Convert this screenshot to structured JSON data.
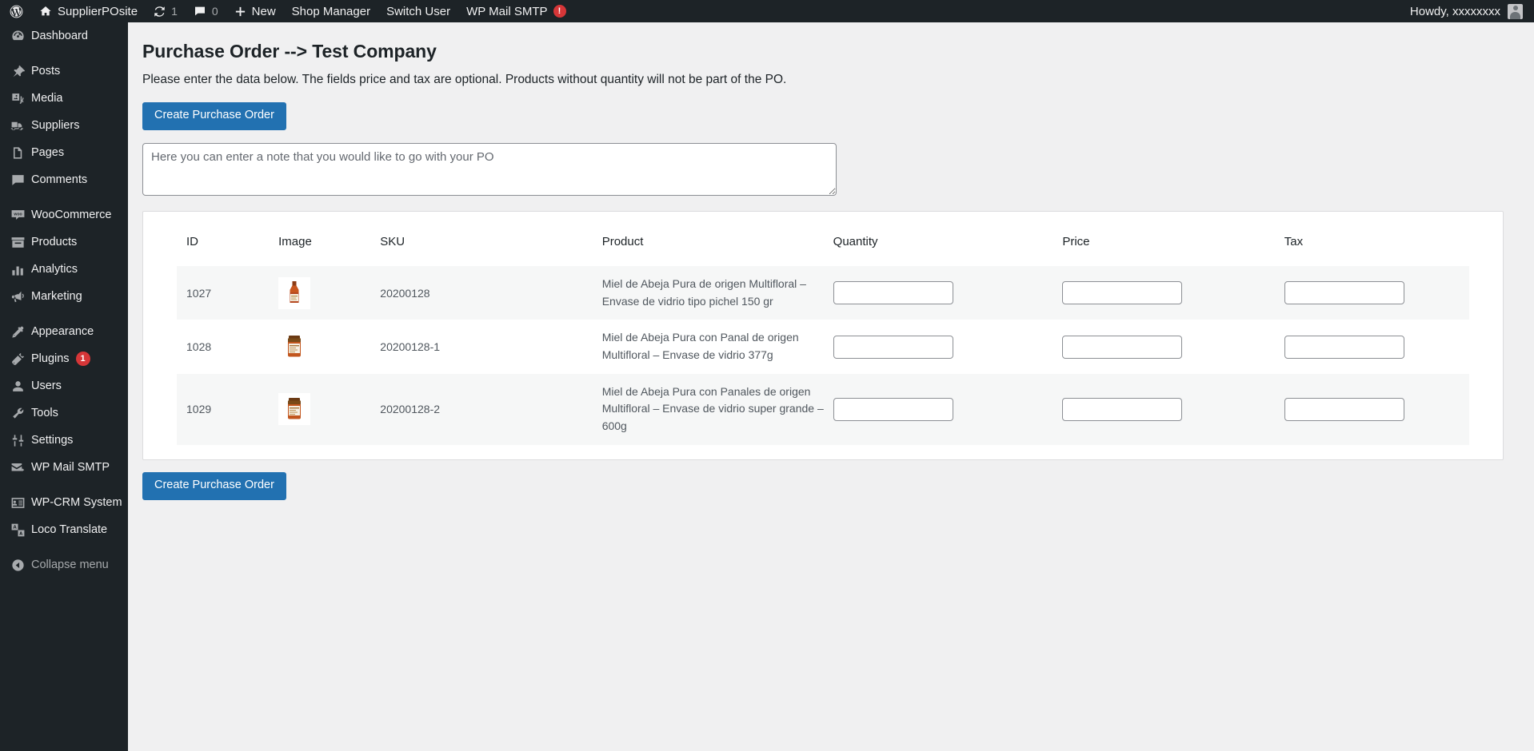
{
  "adminbar": {
    "logo_icon": "wordpress-logo-icon",
    "site_name": "SupplierPOsite",
    "site_icon": "home-icon",
    "updates_icon": "updates-icon",
    "updates_count": "1",
    "comments_icon": "comment-bubble-icon",
    "comments_count": "0",
    "new_icon": "plus-icon",
    "new_label": "New",
    "shop_manager_label": "Shop Manager",
    "switch_user_label": "Switch User",
    "wp_mail_smtp_label": "WP Mail SMTP",
    "wp_mail_smtp_badge": "!",
    "howdy_label": "Howdy, xxxxxxxx",
    "avatar_icon": "user-avatar-icon",
    "badge_color": "#d63638"
  },
  "sidebar": {
    "items": [
      {
        "label": "Dashboard",
        "icon": "dashboard-icon",
        "gap_before": false
      },
      {
        "label": "Posts",
        "icon": "pin-icon",
        "gap_before": true
      },
      {
        "label": "Media",
        "icon": "media-icon",
        "gap_before": false
      },
      {
        "label": "Suppliers",
        "icon": "truck-icon",
        "gap_before": false
      },
      {
        "label": "Pages",
        "icon": "page-icon",
        "gap_before": false
      },
      {
        "label": "Comments",
        "icon": "comment-icon",
        "gap_before": false
      },
      {
        "label": "WooCommerce",
        "icon": "woo-icon",
        "gap_before": true
      },
      {
        "label": "Products",
        "icon": "products-icon",
        "gap_before": false
      },
      {
        "label": "Analytics",
        "icon": "chart-bars-icon",
        "gap_before": false
      },
      {
        "label": "Marketing",
        "icon": "megaphone-icon",
        "gap_before": false
      },
      {
        "label": "Appearance",
        "icon": "brush-icon",
        "gap_before": true
      },
      {
        "label": "Plugins",
        "icon": "plug-icon",
        "gap_before": false,
        "badge": "1"
      },
      {
        "label": "Users",
        "icon": "user-icon",
        "gap_before": false
      },
      {
        "label": "Tools",
        "icon": "wrench-icon",
        "gap_before": false
      },
      {
        "label": "Settings",
        "icon": "sliders-icon",
        "gap_before": false
      },
      {
        "label": "WP Mail SMTP",
        "icon": "mail-icon",
        "gap_before": false
      },
      {
        "label": "WP-CRM System",
        "icon": "id-card-icon",
        "gap_before": true
      },
      {
        "label": "Loco Translate",
        "icon": "translate-icon",
        "gap_before": false
      },
      {
        "label": "Collapse menu",
        "icon": "collapse-icon",
        "gap_before": true
      }
    ]
  },
  "page": {
    "title": "Purchase Order --> Test Company",
    "description": "Please enter the data below. The fields price and tax are optional. Products without quantity will not be part of the PO.",
    "create_button_top": "Create Purchase Order",
    "create_button_bottom": "Create Purchase Order",
    "note_placeholder": "Here you can enter a note that you would like to go with your PO",
    "note_value": "",
    "accent_color": "#2271b1"
  },
  "table": {
    "headers": [
      "ID",
      "Image",
      "SKU",
      "Product",
      "Quantity",
      "Price",
      "Tax"
    ],
    "rows": [
      {
        "id": "1027",
        "image_icon": "honey-bottle-thumbnail",
        "sku": "20200128",
        "product": "Miel de Abeja Pura de origen Multifloral – Envase de vidrio tipo pichel 150 gr",
        "quantity": "",
        "price": "",
        "tax": ""
      },
      {
        "id": "1028",
        "image_icon": "honey-jar-thumbnail",
        "sku": "20200128-1",
        "product": "Miel de Abeja Pura con Panal de origen Multifloral – Envase de vidrio 377g",
        "quantity": "",
        "price": "",
        "tax": ""
      },
      {
        "id": "1029",
        "image_icon": "honey-jar-thumbnail",
        "sku": "20200128-2",
        "product": "Miel de Abeja Pura con Panales de origen Multifloral – Envase de vidrio super grande – 600g",
        "quantity": "",
        "price": "",
        "tax": ""
      }
    ]
  }
}
